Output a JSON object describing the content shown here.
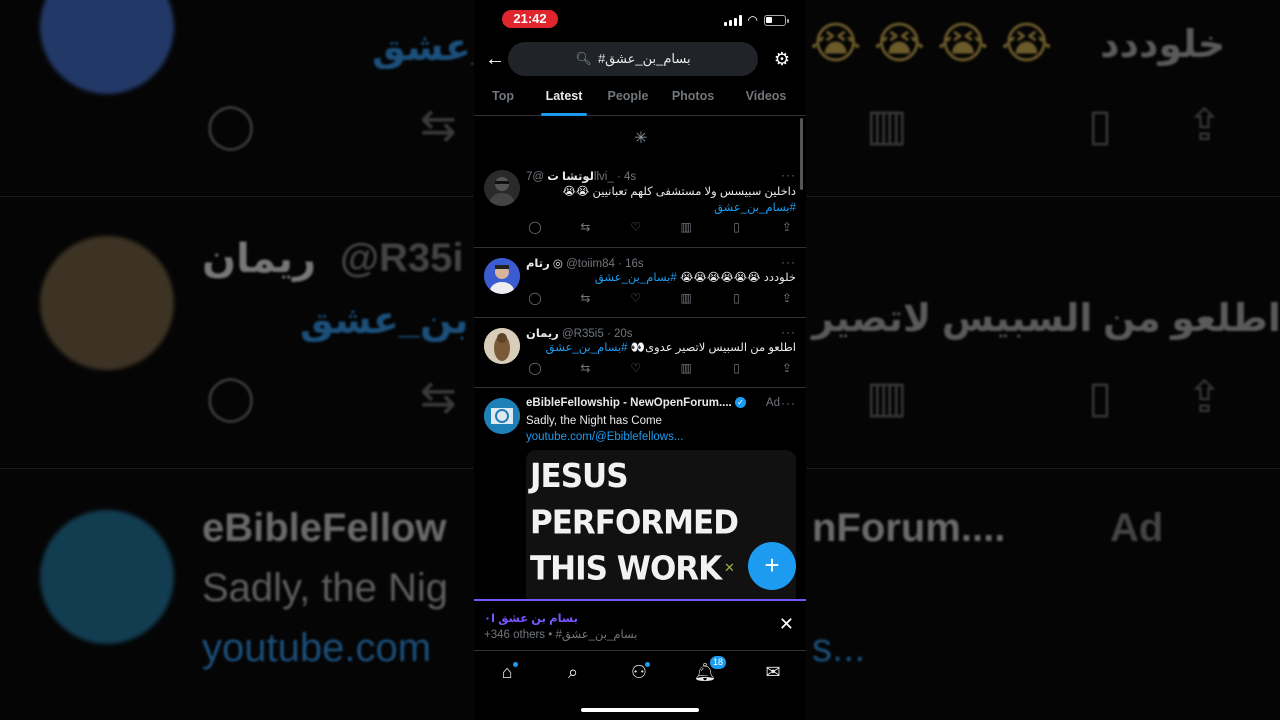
{
  "status_bar": {
    "time": "21:42"
  },
  "search": {
    "query": "#بسام_بن_عشق"
  },
  "tabs": [
    {
      "label": "Top"
    },
    {
      "label": "Latest"
    },
    {
      "label": "People"
    },
    {
      "label": "Photos"
    },
    {
      "label": "Videos"
    }
  ],
  "tweets": [
    {
      "name": "لوتشا ت",
      "handle": "@7llvi_",
      "time": "· 4s",
      "text": "داخلين سبيسس ولا مستشفى كلهم تعبانيين 😭😭",
      "hashtag": "#بسام_بن_عشق"
    },
    {
      "name": "رتام ◎",
      "handle": "@toiim84",
      "time": "· 16s",
      "text": "خلوددد 😭😭😭😭😭😭",
      "hashtag": "#بسام_بن_عشق"
    },
    {
      "name": "ريمان",
      "handle": "@R35i5",
      "time": "· 20s",
      "text": "اطلعو من السبيس لاتصير عدوى👀",
      "hashtag": "#بسام_بن_عشق"
    }
  ],
  "ad": {
    "name": "eBibleFellowship - NewOpenForum....",
    "ad_label": "Ad",
    "text": "Sadly, the Night has Come",
    "link": "youtube.com/@Ebiblefellows...",
    "image_headline": "JESUS PERFORMED THIS WORK WHIL"
  },
  "banner": {
    "title": "بسام بن عشق ا٠",
    "subtitle": "+346 others • #بسام_بن_عشق"
  },
  "nav": {
    "notifications_badge": "18"
  },
  "background": {
    "top_text": "خلوددد",
    "top_link": "بن_عشق",
    "mid_name": "ريمان",
    "mid_handle": "@R35i",
    "mid_link": "بن_عشق",
    "mid_text": "اطلعو من السبيس لاتصير",
    "ad_name_left": "eBibleFellow",
    "ad_name_right": "nForum....",
    "ad_label": "Ad",
    "ad_text": "Sadly, the Nig",
    "ad_link": "youtube.com",
    "ad_link_right": "s..."
  }
}
